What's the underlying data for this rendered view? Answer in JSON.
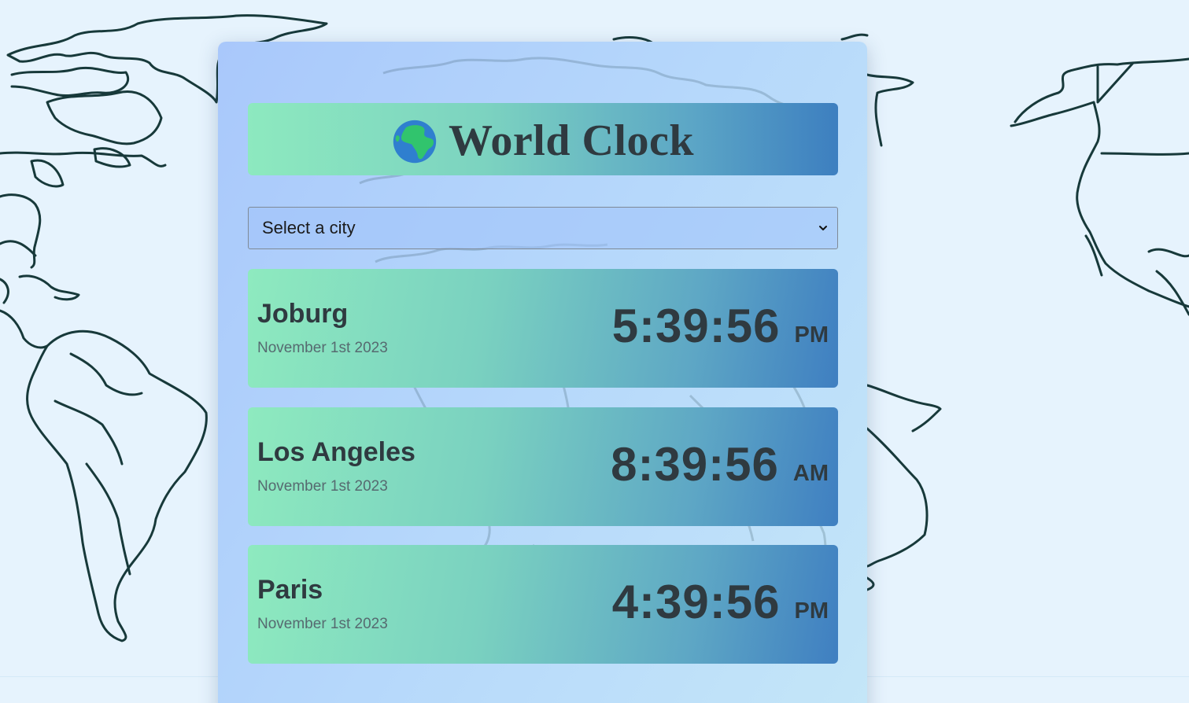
{
  "app": {
    "title": "World Clock"
  },
  "city_select": {
    "selected_label": "Select a city"
  },
  "cities": [
    {
      "name": "Joburg",
      "date": "November 1st 2023",
      "time": "5:39:56",
      "period": "PM"
    },
    {
      "name": "Los Angeles",
      "date": "November 1st 2023",
      "time": "8:39:56",
      "period": "AM"
    },
    {
      "name": "Paris",
      "date": "November 1st 2023",
      "time": "4:39:56",
      "period": "PM"
    }
  ],
  "icons": {
    "header_icon": "globe-europe-africa-icon",
    "select_icon": "chevron-down-icon"
  },
  "colors": {
    "page_background": "#e6f3fd",
    "card_gradient_start": "#a9c8fb",
    "card_gradient_end": "#c4e6f8",
    "header_gradient_start": "#8de9bf",
    "header_gradient_end": "#3d7fc0",
    "text_dark": "#2f3a40",
    "date_text": "#566a70",
    "map_outline": "#17393a"
  }
}
